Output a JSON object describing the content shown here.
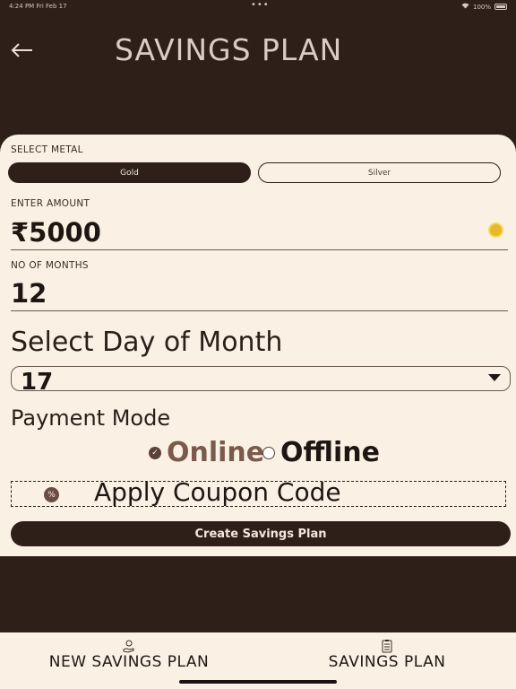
{
  "status_bar": {
    "time": "4:24 PM  Fri Feb 17",
    "dots": "•••",
    "battery": "100%"
  },
  "header": {
    "title": "SAVINGS PLAN",
    "back_icon": "arrow-left-icon"
  },
  "form": {
    "select_metal_label": "SELECT METAL",
    "metals": [
      {
        "label": "Gold",
        "selected": true
      },
      {
        "label": "Silver",
        "selected": false
      }
    ],
    "enter_amount_label": "ENTER AMOUNT",
    "amount_value": "₹5000",
    "no_of_months_label": "NO OF MONTHS",
    "months_value": "12",
    "select_day_title": "Select Day of Month",
    "day_value": "17",
    "payment_mode_title": "Payment Mode",
    "payment_options": [
      {
        "label": "Online",
        "selected": true
      },
      {
        "label": "Offline",
        "selected": false
      }
    ],
    "coupon_text": "Apply Coupon Code",
    "create_button_label": "Create Savings Plan"
  },
  "bottom_nav": {
    "items": [
      {
        "label": "NEW SAVINGS PLAN",
        "icon": "hand-coin-icon"
      },
      {
        "label": "SAVINGS PLAN",
        "icon": "clipboard-icon"
      }
    ]
  },
  "colors": {
    "background": "#2e1f19",
    "card": "#faf1e4",
    "accent": "#7a5a4c",
    "coin": "#e8b827"
  }
}
